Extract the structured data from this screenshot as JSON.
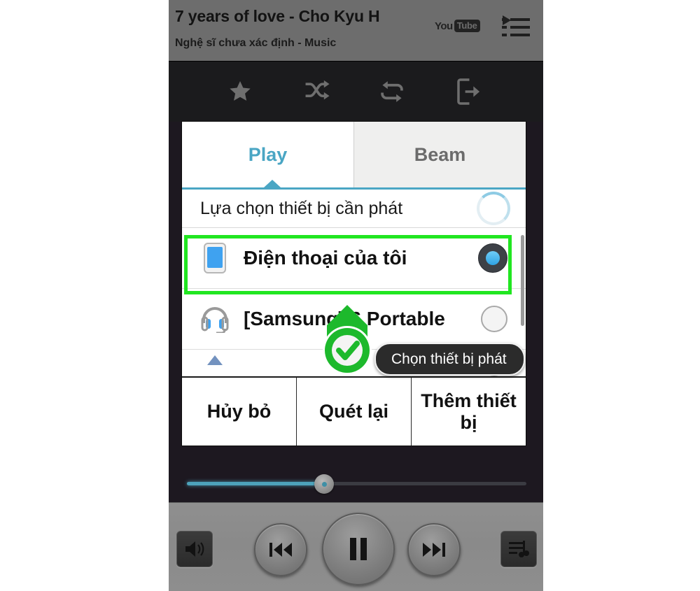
{
  "now_playing": {
    "title": "7 years of love - Cho Kyu H",
    "subtitle": "Nghệ sĩ chưa xác định  -  Music",
    "youtube_logo_you": "You",
    "youtube_logo_tube": "Tube",
    "playlist_icon": "playlist-play-icon"
  },
  "options_bar": {
    "items": [
      {
        "name": "star-icon",
        "label": "Yêu thích"
      },
      {
        "name": "shuffle-icon",
        "label": "Phát ngẫu nhiên"
      },
      {
        "name": "repeat-icon",
        "label": "Lặp lại"
      },
      {
        "name": "beam-out-icon",
        "label": "Phát ra thiết bị"
      }
    ]
  },
  "dialog": {
    "tabs": [
      {
        "label": "Play",
        "active": true
      },
      {
        "label": "Beam",
        "active": false
      }
    ],
    "prompt": "Lựa chọn thiết bị cần phát",
    "spinner": "scanning-spinner",
    "devices": [
      {
        "label": "Điện thoại của tôi",
        "icon": "phone-icon",
        "selected": true,
        "highlighted": true
      },
      {
        "label": "[Samsung] 6 Portable",
        "icon": "headset-icon",
        "selected": false,
        "highlighted": false
      },
      {
        "label": "",
        "icon": "device-icon",
        "selected": false,
        "highlighted": false
      }
    ],
    "buttons": [
      {
        "label": "Hủy bỏ"
      },
      {
        "label": "Quét lại"
      },
      {
        "label": "Thêm thiết bị"
      }
    ]
  },
  "player": {
    "progress_percent": 40,
    "controls": [
      {
        "name": "volume-button",
        "label": "Âm lượng"
      },
      {
        "name": "previous-button",
        "label": "Bài trước"
      },
      {
        "name": "pause-button",
        "label": "Tạm dừng"
      },
      {
        "name": "next-button",
        "label": "Bài tiếp"
      },
      {
        "name": "playlist-button",
        "label": "Danh sách phát"
      }
    ]
  },
  "annotation": {
    "tooltip": "Chọn thiết bị phát",
    "cursor_icon": "green-check-pin-cursor",
    "highlight_color": "#21e621"
  }
}
